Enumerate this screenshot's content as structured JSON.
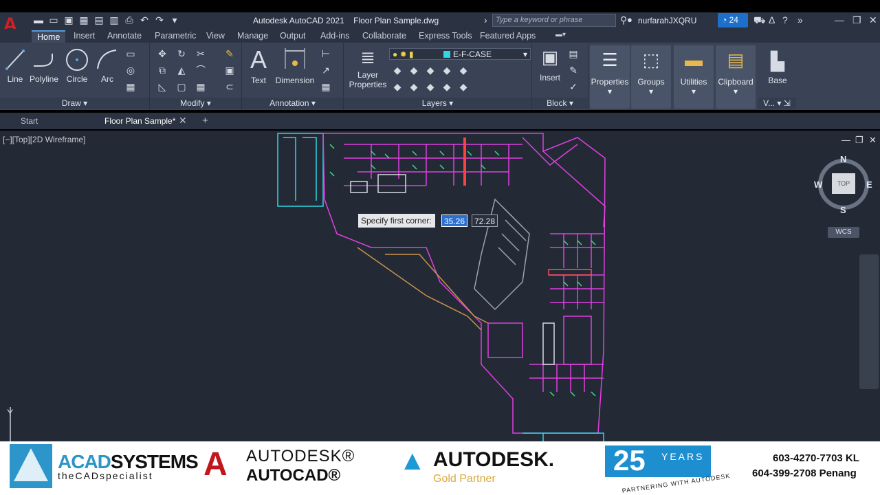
{
  "titlebar": {
    "app_title": "Autodesk AutoCAD 2021",
    "file_name": "Floor Plan Sample.dwg",
    "search_placeholder": "Type a keyword or phrase",
    "user": "nurfarahJXQRU",
    "clock_count": "24"
  },
  "ribbon_tabs": [
    "Home",
    "Insert",
    "Annotate",
    "Parametric",
    "View",
    "Manage",
    "Output",
    "Add-ins",
    "Collaborate",
    "Express Tools",
    "Featured Apps"
  ],
  "draw_panel": {
    "title": "Draw",
    "tools": [
      "Line",
      "Polyline",
      "Circle",
      "Arc"
    ]
  },
  "modify_panel": {
    "title": "Modify"
  },
  "annotation_panel": {
    "title": "Annotation",
    "tools": [
      "Text",
      "Dimension"
    ]
  },
  "layers_panel": {
    "title": "Layers",
    "tool": "Layer Properties",
    "current_layer": "E-F-CASE",
    "layer_color": "#2fd6e4"
  },
  "block_panel": {
    "title": "Block",
    "tool": "Insert"
  },
  "big_buttons": [
    "Properties",
    "Groups",
    "Utilities",
    "Clipboard"
  ],
  "view_panel": {
    "tool": "Base",
    "title": "V..."
  },
  "doc_tabs": {
    "start": "Start",
    "active": "Floor Plan Sample*"
  },
  "viewport": {
    "label": "[−][Top][2D Wireframe]",
    "prompt": "Specify first corner:",
    "coord_x": "35.26",
    "coord_y": "72.28",
    "compass": {
      "n": "N",
      "s": "S",
      "e": "E",
      "w": "W",
      "face": "TOP"
    },
    "wcs": "WCS",
    "y_axis": "Y"
  },
  "footer": {
    "acad_part1": "ACAD",
    "acad_part2": "SYSTEMS",
    "acad_tagline": "theCADspecialist",
    "autodesk_autocad_1": "AUTODESK®",
    "autodesk_autocad_2": "AUTOCAD®",
    "autodesk_gold_1": "AUTODESK.",
    "autodesk_gold_2": "Gold Partner",
    "years_num": "25",
    "years_word": "YEARS",
    "years_partner": "PARTNERING WITH AUTODESK",
    "phone_kl": "603-4270-7703 KL",
    "phone_penang": "604-399-2708 Penang"
  },
  "colors": {
    "accent": "#1e6fc9",
    "walls": "#e040e0",
    "cyan": "#2fd6e4",
    "green": "#3ddc84",
    "dark_bg": "#232a36"
  }
}
